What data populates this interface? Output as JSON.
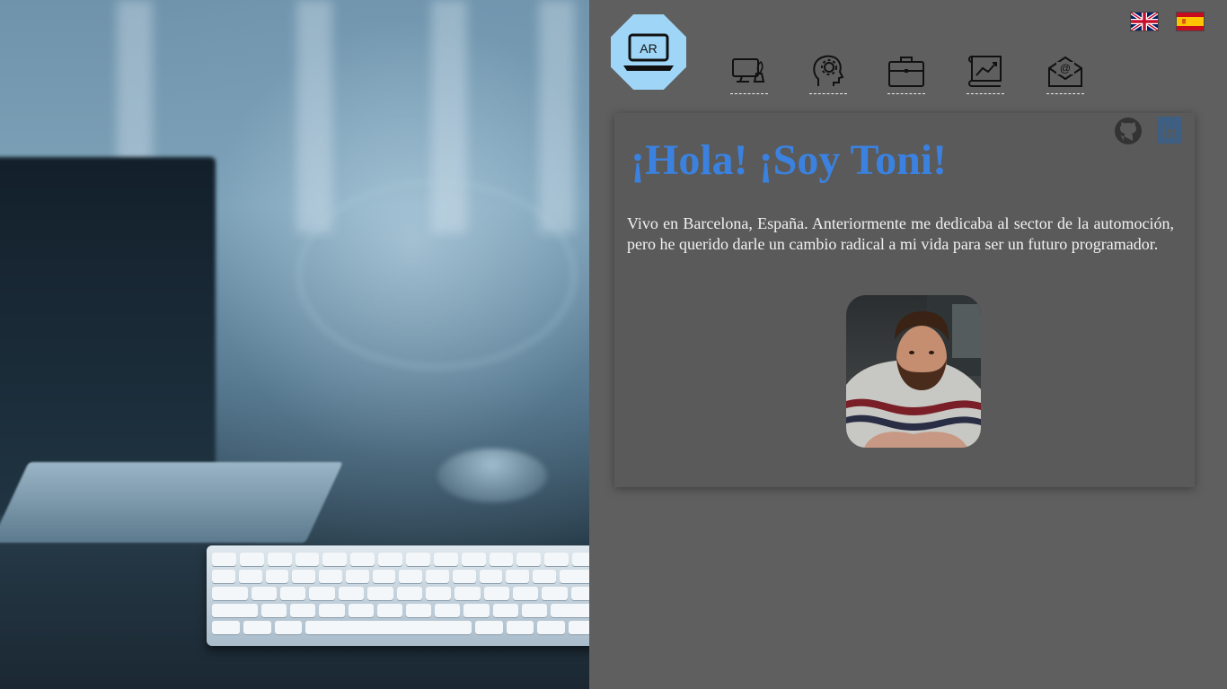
{
  "header": {
    "logo_text": "AR",
    "nav": [
      {
        "id": "projects",
        "icon": "monitor-plant-icon"
      },
      {
        "id": "skills",
        "icon": "head-gear-icon"
      },
      {
        "id": "experience",
        "icon": "briefcase-icon"
      },
      {
        "id": "studies",
        "icon": "chart-scroll-icon"
      },
      {
        "id": "contact",
        "icon": "envelope-at-icon"
      }
    ],
    "languages": [
      {
        "code": "en",
        "icon": "uk-flag-icon"
      },
      {
        "code": "es",
        "icon": "spain-flag-icon"
      }
    ]
  },
  "intro": {
    "title": "¡Hola! ¡Soy Toni!",
    "text": "Vivo en Barcelona, España. Anteriormente me dedicaba al sector de la automoción, pero he querido darle un cambio radical a mi vida para ser un futuro programador.",
    "social": [
      {
        "name": "github",
        "icon": "github-icon"
      },
      {
        "name": "linkedin",
        "icon": "linkedin-icon",
        "label": "in"
      }
    ]
  },
  "colors": {
    "accent": "#3b82e0",
    "background": "#5f5f5f",
    "card": "#5a5a5a",
    "logo": "#9fd6f7"
  }
}
